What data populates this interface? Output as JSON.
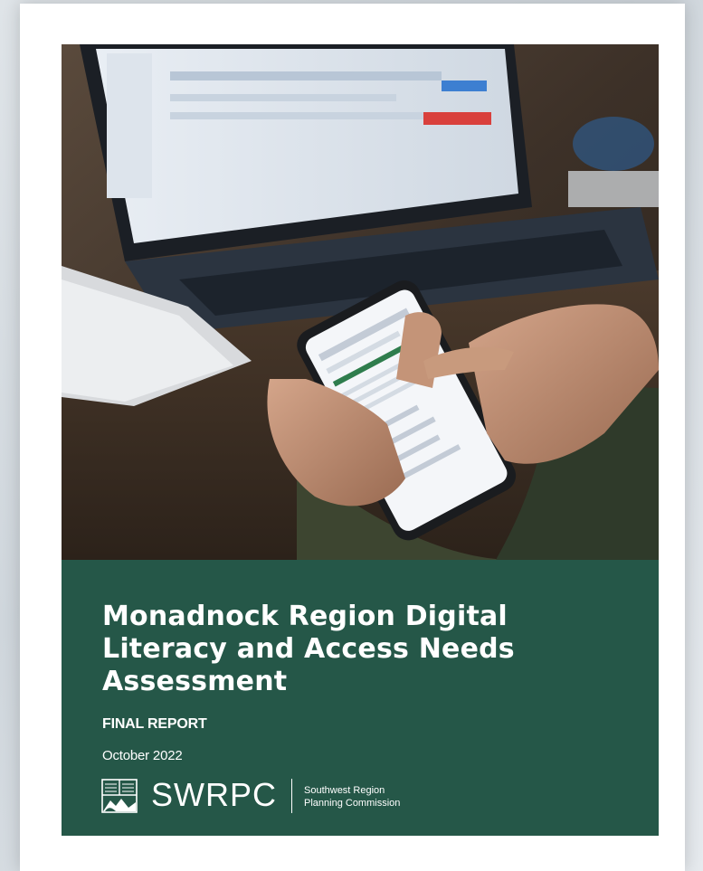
{
  "report": {
    "title": "Monadnock Region Digital Literacy and Access Needs Assessment",
    "subtitle": "FINAL REPORT",
    "date": "October 2022"
  },
  "organization": {
    "acronym": "SWRPC",
    "name_line1": "Southwest Region",
    "name_line2": "Planning Commission",
    "logo_icon": "swrpc-logo-icon"
  },
  "cover_photo": {
    "icon": "photo-hands-smartphone-laptop"
  },
  "colors": {
    "band": "#255748",
    "page": "#ffffff",
    "text": "#ffffff"
  }
}
